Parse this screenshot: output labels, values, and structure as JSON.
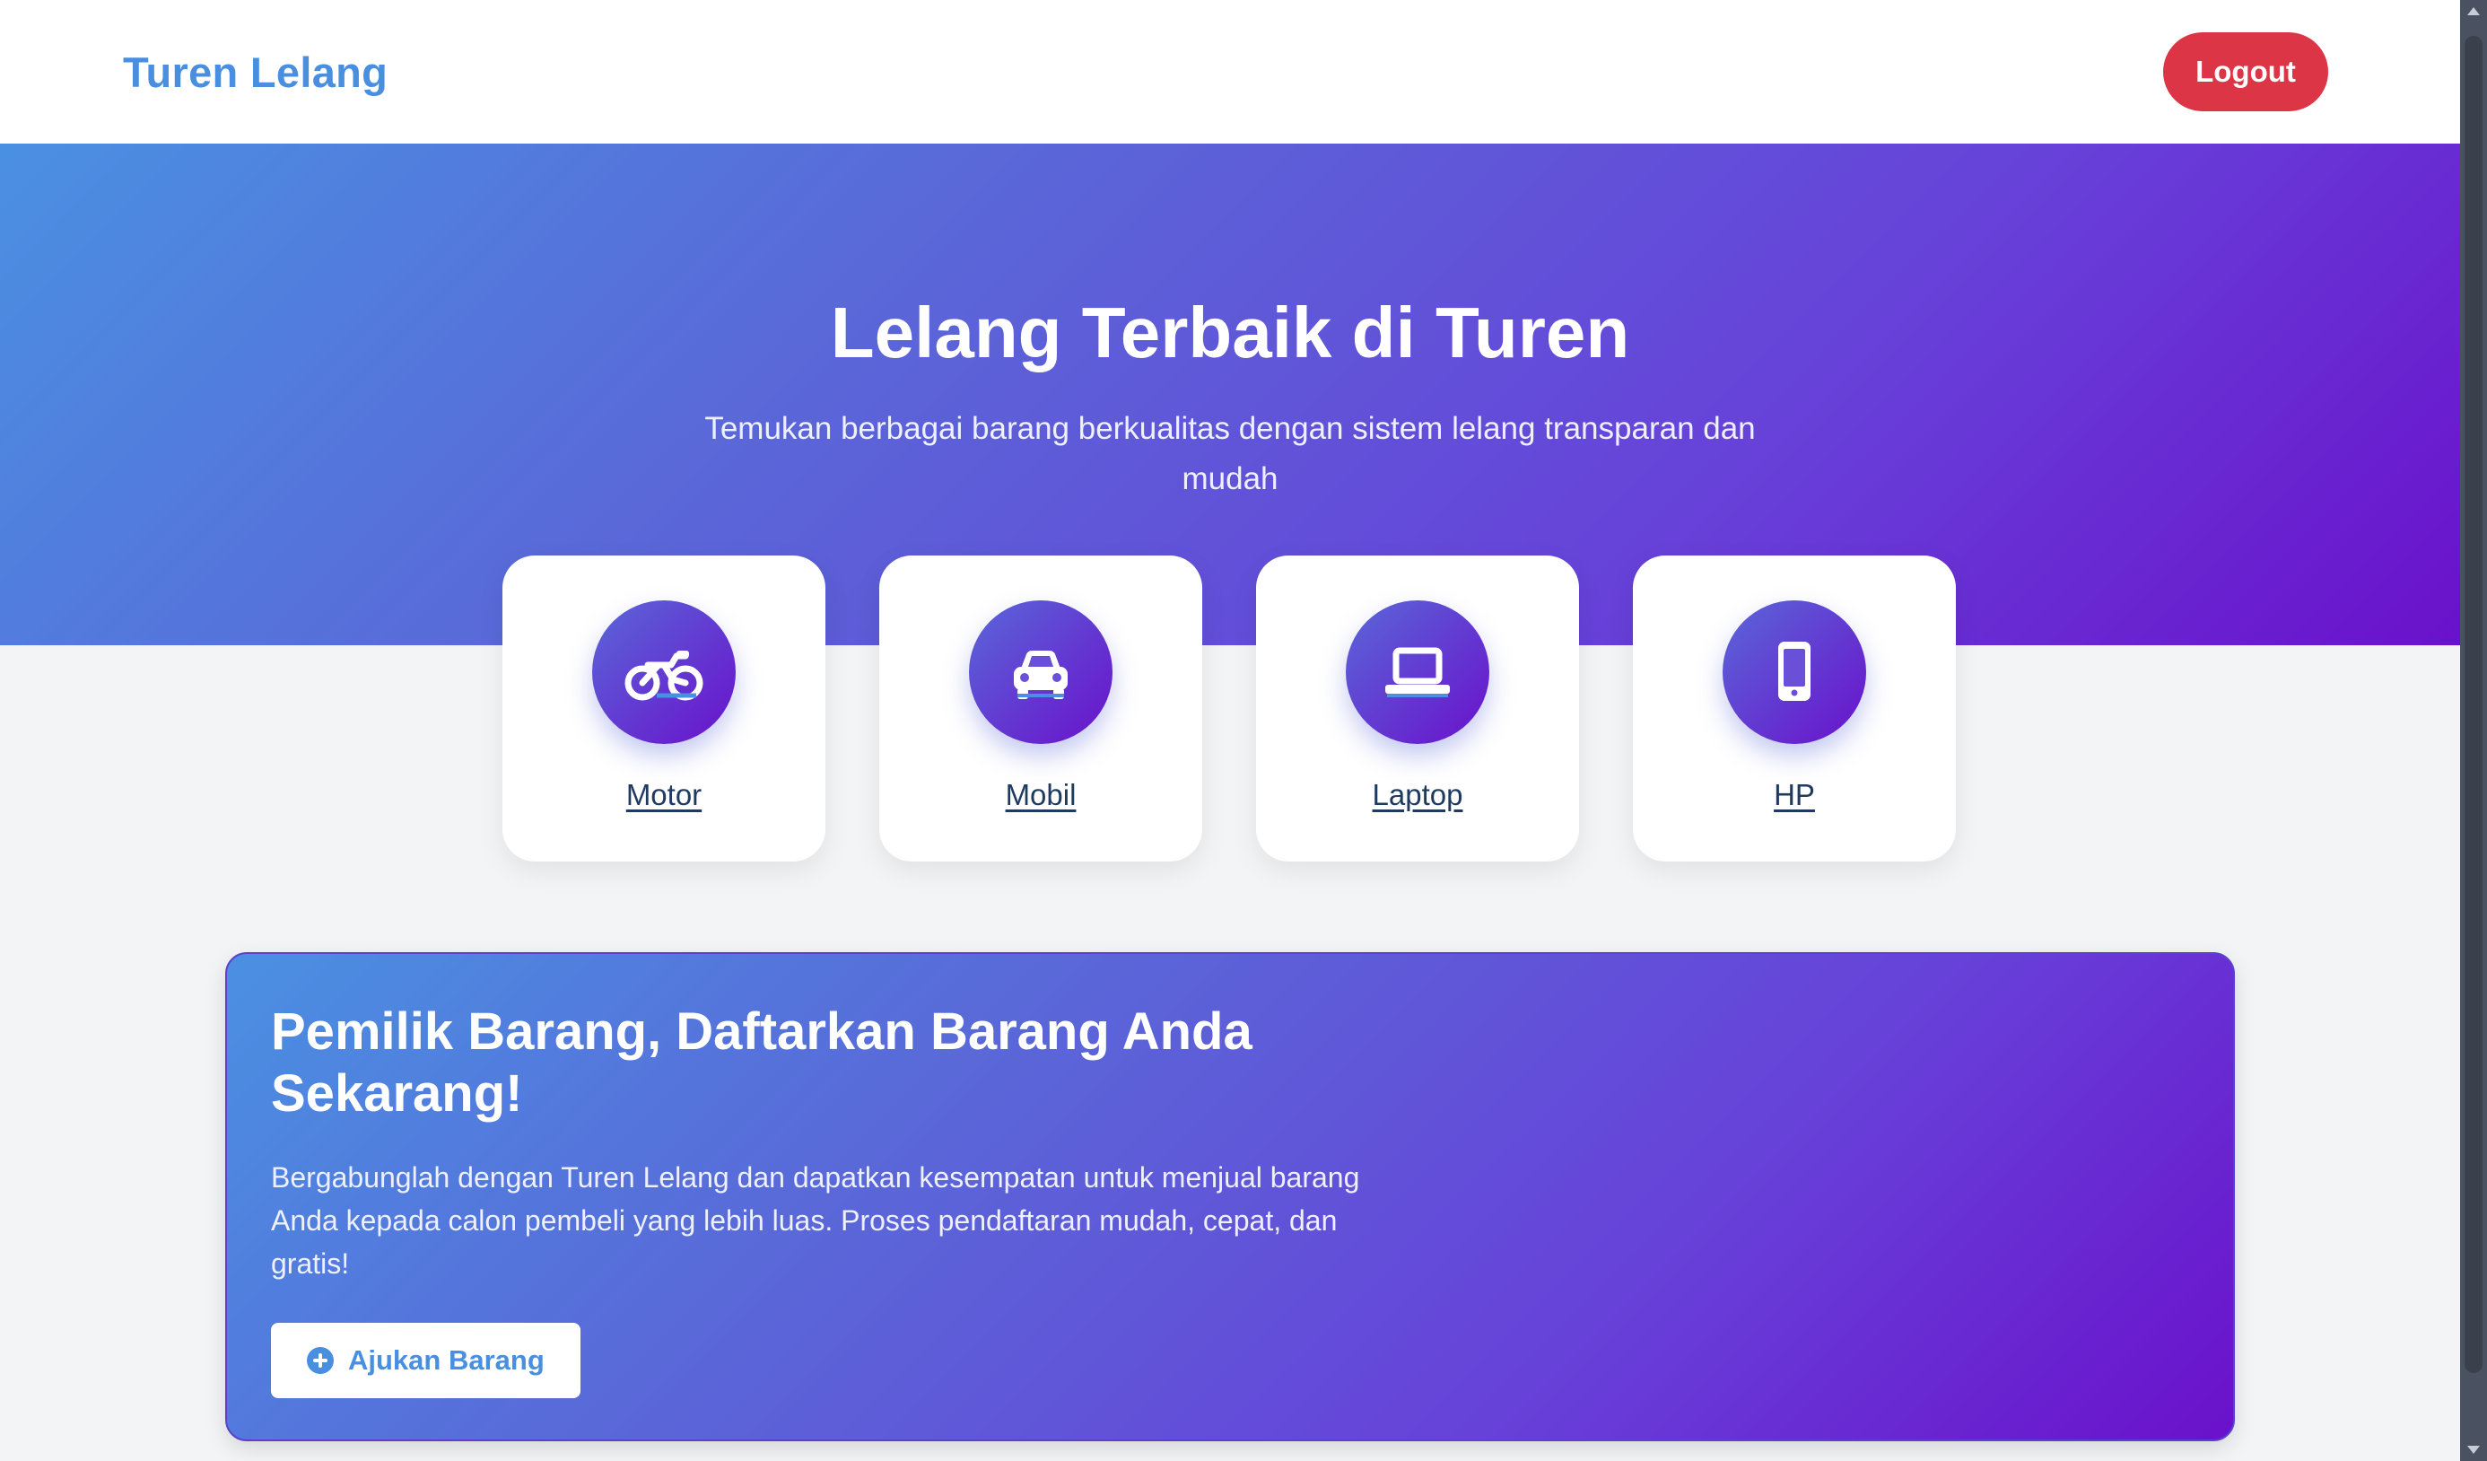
{
  "navbar": {
    "brand": "Turen Lelang",
    "logout_label": "Logout"
  },
  "hero": {
    "title": "Lelang Terbaik di Turen",
    "subtitle": "Temukan berbagai barang berkualitas dengan sistem lelang transparan dan mudah"
  },
  "categories": [
    {
      "label": "Motor",
      "icon": "motorcycle-icon"
    },
    {
      "label": "Mobil",
      "icon": "car-icon"
    },
    {
      "label": "Laptop",
      "icon": "laptop-icon"
    },
    {
      "label": "HP",
      "icon": "mobile-phone-icon"
    }
  ],
  "cta": {
    "title": "Pemilik Barang, Daftarkan Barang Anda Sekarang!",
    "text": "Bergabunglah dengan Turen Lelang dan dapatkan kesempatan untuk menjual barang Anda kepada calon pembeli yang lebih luas. Proses pendaftaran mudah, cepat, dan gratis!",
    "button_label": "Ajukan Barang",
    "button_icon": "plus-circle-icon"
  },
  "colors": {
    "brand": "#4a8fdf",
    "logout": "#dc3545",
    "gradient_start": "#4a90e2",
    "gradient_end": "#6a11cb",
    "category_label": "#1e3a5f",
    "page_background": "#f3f4f6"
  }
}
